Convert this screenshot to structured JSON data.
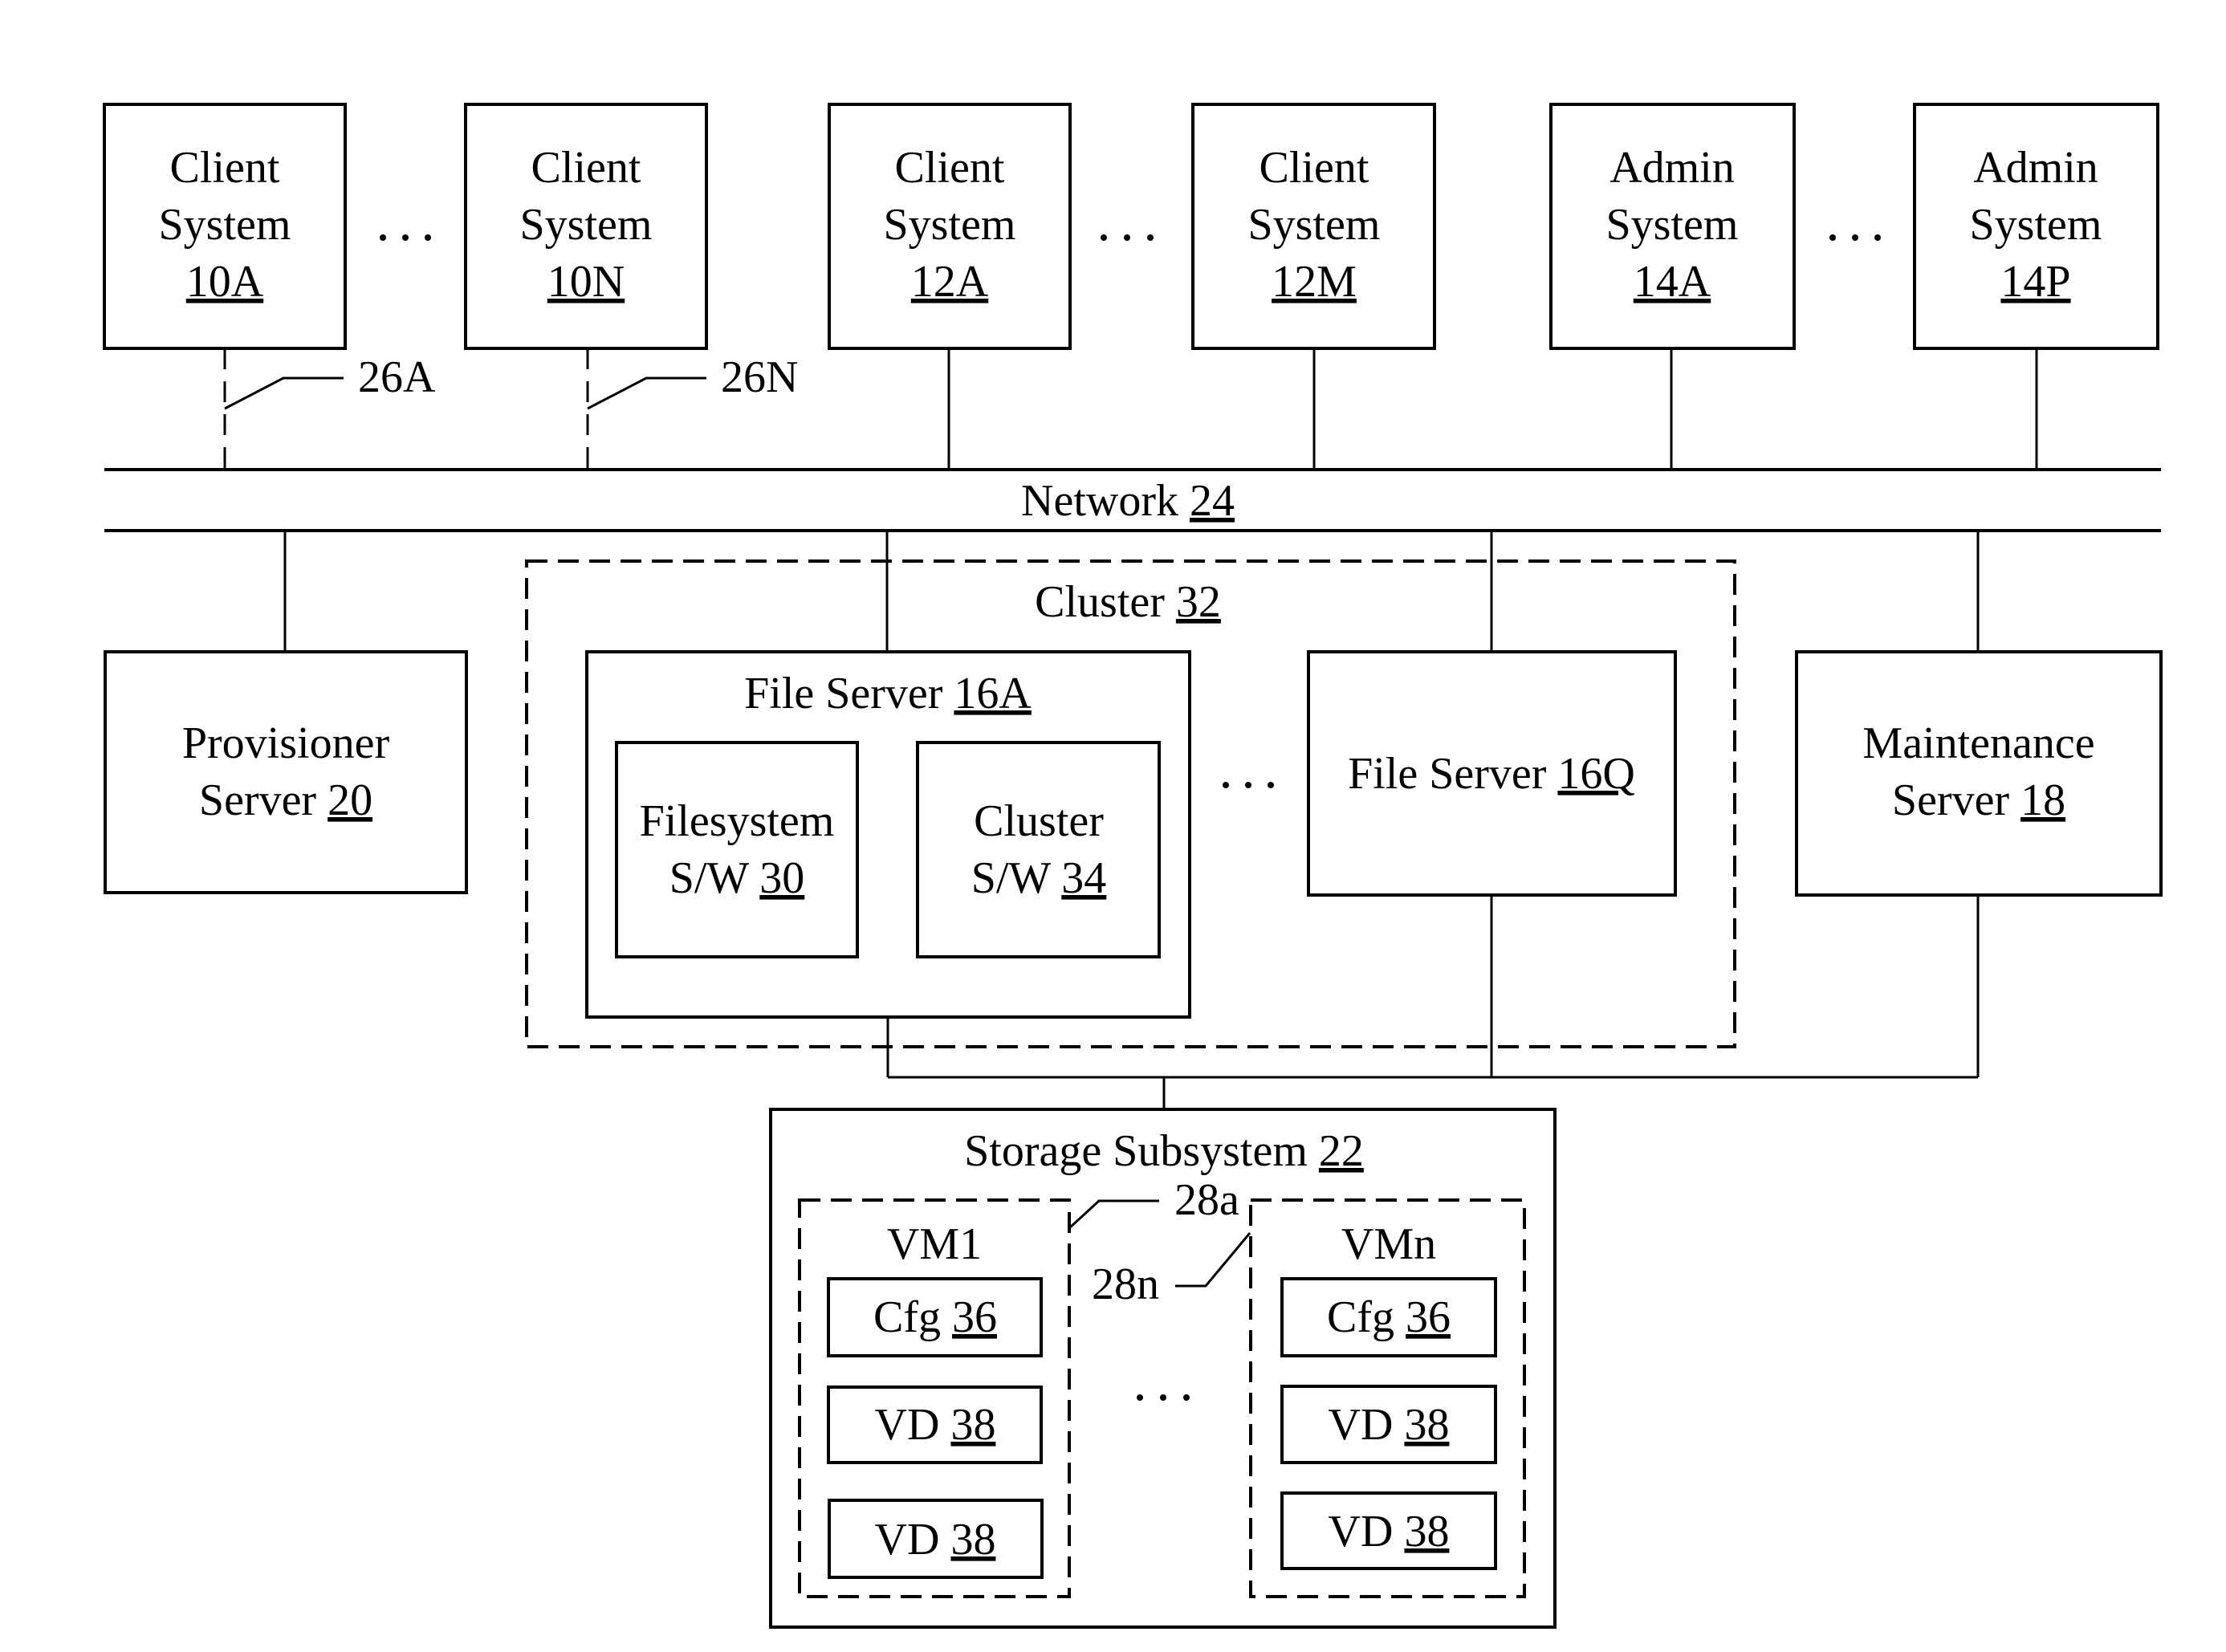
{
  "diagram": {
    "network": {
      "label": "Network",
      "ref": "24"
    },
    "top_row": [
      {
        "line1": "Client",
        "line2": "System",
        "ref": "10A",
        "link": "26A",
        "link_style": "dashed"
      },
      {
        "line1": "Client",
        "line2": "System",
        "ref": "10N",
        "link": "26N",
        "link_style": "dashed"
      },
      {
        "line1": "Client",
        "line2": "System",
        "ref": "12A",
        "link_style": "solid"
      },
      {
        "line1": "Client",
        "line2": "System",
        "ref": "12M",
        "link_style": "solid"
      },
      {
        "line1": "Admin",
        "line2": "System",
        "ref": "14A",
        "link_style": "solid"
      },
      {
        "line1": "Admin",
        "line2": "System",
        "ref": "14P",
        "link_style": "solid"
      }
    ],
    "ellipsis": "...",
    "provisioner": {
      "line1": "Provisioner",
      "line2": "Server",
      "ref": "20"
    },
    "cluster": {
      "label": "Cluster",
      "ref": "32",
      "file_server_a": {
        "label": "File Server",
        "ref": "16A",
        "filesystem_sw": {
          "line1": "Filesystem",
          "line2": "S/W",
          "ref": "30"
        },
        "cluster_sw": {
          "line1": "Cluster",
          "line2": "S/W",
          "ref": "34"
        }
      },
      "file_server_q": {
        "label": "File Server",
        "ref": "16Q"
      }
    },
    "maintenance": {
      "line1": "Maintenance",
      "line2": "Server",
      "ref": "18"
    },
    "storage": {
      "label": "Storage Subsystem",
      "ref": "22",
      "vm_first": {
        "label": "VM1",
        "callout": "28a",
        "items": [
          {
            "label": "Cfg",
            "ref": "36"
          },
          {
            "label": "VD",
            "ref": "38"
          },
          {
            "label": "VD",
            "ref": "38"
          }
        ]
      },
      "vm_last": {
        "label": "VMn",
        "callout": "28n",
        "items": [
          {
            "label": "Cfg",
            "ref": "36"
          },
          {
            "label": "VD",
            "ref": "38"
          },
          {
            "label": "VD",
            "ref": "38"
          }
        ]
      }
    }
  }
}
